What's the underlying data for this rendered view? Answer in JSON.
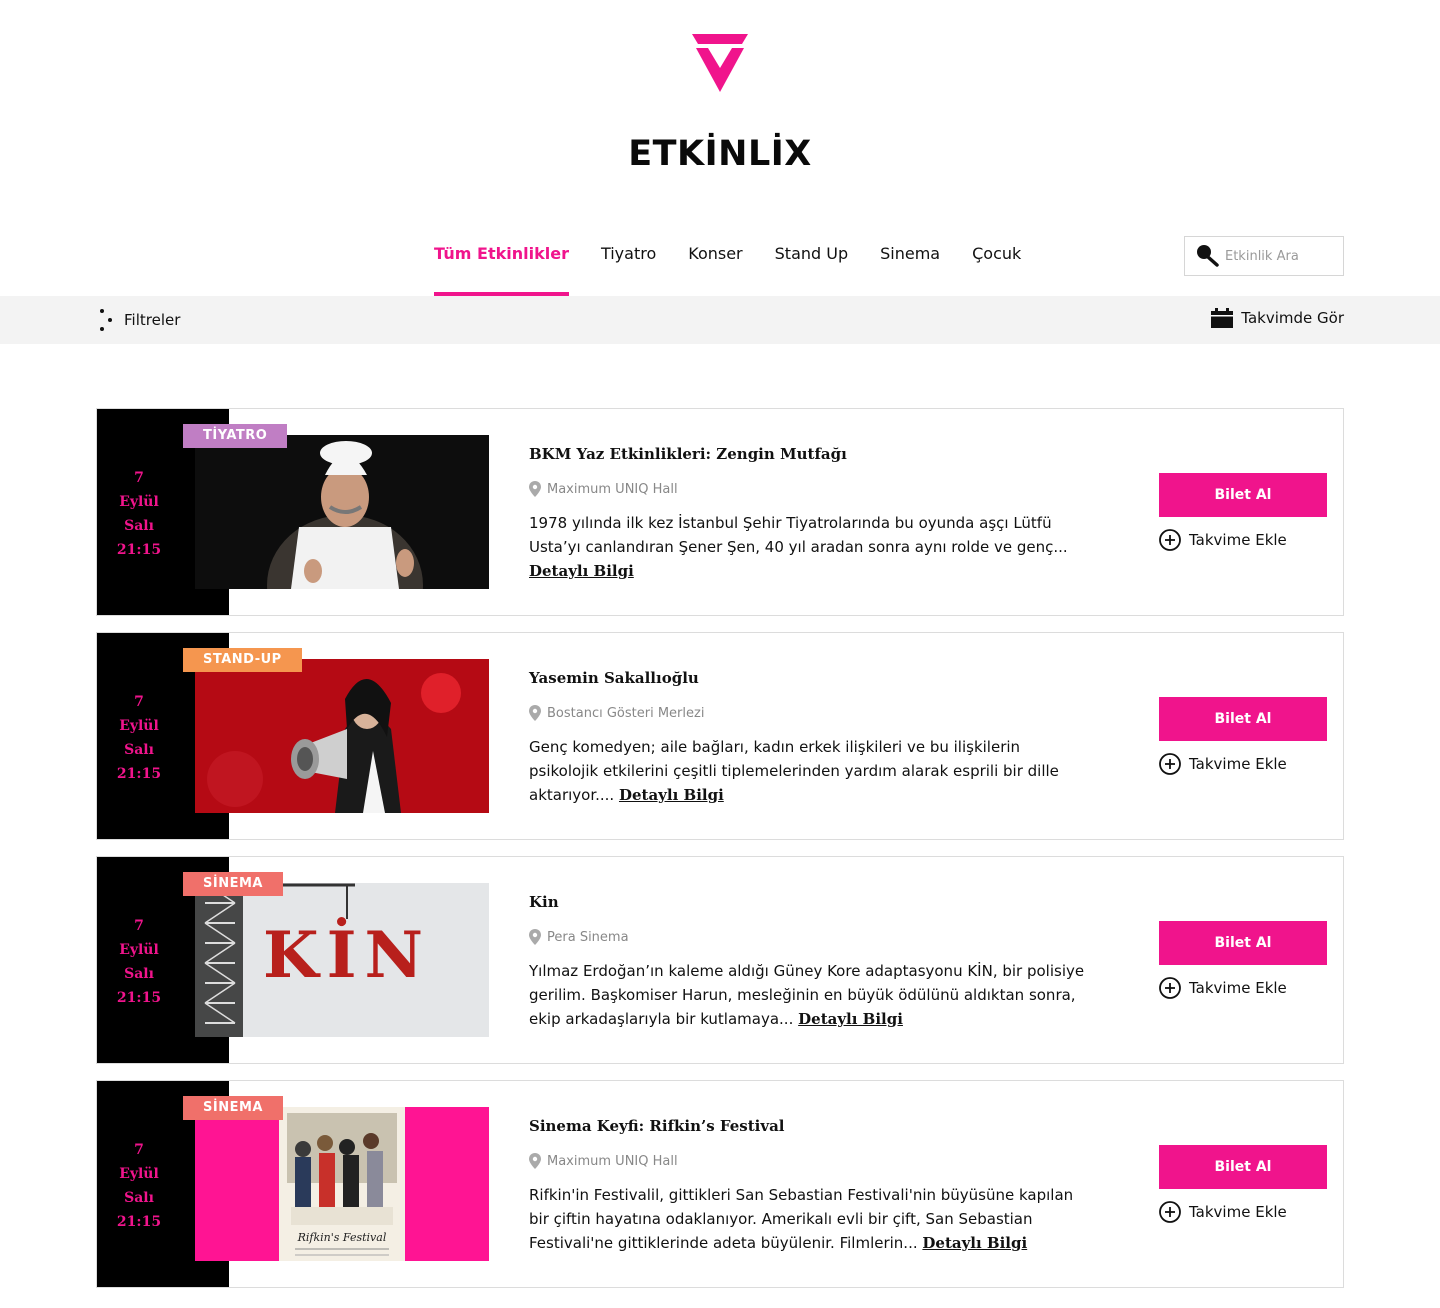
{
  "brand": {
    "name": "ETKİNLİX",
    "accent_color": "#f0148c"
  },
  "nav": {
    "tabs": [
      {
        "label": "Tüm Etkinlikler",
        "active": true
      },
      {
        "label": "Tiyatro",
        "active": false
      },
      {
        "label": "Konser",
        "active": false
      },
      {
        "label": "Stand Up",
        "active": false
      },
      {
        "label": "Sinema",
        "active": false
      },
      {
        "label": "Çocuk",
        "active": false
      }
    ]
  },
  "search": {
    "placeholder": "Etkinlik Ara",
    "icon": "search-icon"
  },
  "toolbar": {
    "filters_label": "Filtreler",
    "calendar_view_label": "Takvimde Gör"
  },
  "events": [
    {
      "date": {
        "day": "7",
        "month": "Eylül",
        "weekday": "Salı",
        "time": "21:15"
      },
      "category": "TİYATRO",
      "category_color": "#c07ec4",
      "title": "BKM Yaz Etkinlikleri: Zengin Mutfağı",
      "venue": "Maximum UNIQ Hall",
      "description": "1978 yılında ilk kez İstanbul Şehir Tiyatrolarında bu oyunda aşçı Lütfü Usta’yı canlandıran Şener Şen, 40 yıl aradan sonra aynı rolde ve genç...",
      "more_label": "Detaylı Bilgi",
      "buy_label": "Bilet Al",
      "add_calendar_label": "Takvime Ekle"
    },
    {
      "date": {
        "day": "7",
        "month": "Eylül",
        "weekday": "Salı",
        "time": "21:15"
      },
      "category": "STAND-UP",
      "category_color": "#f5964f",
      "title": "Yasemin Sakallıoğlu",
      "venue": "Bostancı Gösteri Merlezi",
      "description": "Genç komedyen; aile bağları, kadın erkek ilişkileri ve bu ilişkilerin psikolojik etkilerini çeşitli tiplemelerinden yardım alarak esprili bir dille aktarıyor....",
      "more_label": "Detaylı Bilgi",
      "buy_label": "Bilet Al",
      "add_calendar_label": "Takvime Ekle"
    },
    {
      "date": {
        "day": "7",
        "month": "Eylül",
        "weekday": "Salı",
        "time": "21:15"
      },
      "category": "SİNEMA",
      "category_color": "#f0706a",
      "title": "Kin",
      "venue": "Pera Sinema",
      "description": "Yılmaz Erdoğan’ın kaleme aldığı Güney Kore adaptasyonu KİN, bir polisiye gerilim. Başkomiser Harun, mesleğinin en büyük ödülünü aldıktan sonra, ekip arkadaşlarıyla bir kutlamaya...",
      "more_label": "Detaylı Bilgi",
      "buy_label": "Bilet Al",
      "add_calendar_label": "Takvime Ekle",
      "image_text": "KİN"
    },
    {
      "date": {
        "day": "7",
        "month": "Eylül",
        "weekday": "Salı",
        "time": "21:15"
      },
      "category": "SİNEMA",
      "category_color": "#f0706a",
      "title": "Sinema Keyfi: Rifkin’s Festival",
      "venue": "Maximum UNIQ Hall",
      "description": "Rifkin'in Festivalil, gittikleri San Sebastian Festivali'nin büyüsüne kapılan bir çiftin hayatına odaklanıyor. Amerikalı evli bir çift, San Sebastian Festivali'ne gittiklerinde adeta büyülenir. Filmlerin...",
      "more_label": "Detaylı Bilgi",
      "buy_label": "Bilet Al",
      "add_calendar_label": "Takvime Ekle",
      "image_text": "Rifkin's Festival"
    }
  ]
}
